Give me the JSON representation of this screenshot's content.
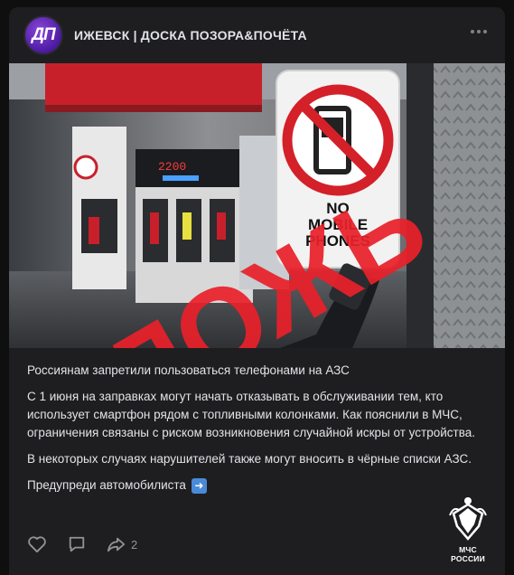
{
  "group": {
    "avatar_text": "ДП",
    "name": "ИЖЕВСК | ДОСКА ПОЗОРА&ПОЧЁТА",
    "menu_icon": "more-horizontal-icon"
  },
  "image": {
    "stamp_text": "ЛОЖЬ",
    "price_display": "2200",
    "sign_text": [
      "NO",
      "MOBILE",
      "PHONES"
    ]
  },
  "post": {
    "title": "Россиянам запретили пользоваться телефонами на АЗС",
    "paragraph1": "С 1 июня на заправках могут начать отказывать в обслуживании тем, кто использует смартфон рядом с топливными колонками. Как пояснили в МЧС, ограничения связаны с риском возникновения случайной искры от устройства.",
    "paragraph2": "В некоторых случаях нарушителей также могут вносить в чёрные списки АЗС.",
    "cta": "Предупреди автомобилиста",
    "cta_icon": "arrow-right-icon"
  },
  "actions": {
    "like_icon": "heart-icon",
    "comment_icon": "comment-icon",
    "share_icon": "share-icon",
    "share_count": "2"
  },
  "watermark": {
    "text": "МЧС РОССИИ"
  },
  "colors": {
    "card_bg": "#1e1e20",
    "page_bg": "#0f0f10",
    "stamp_red": "#e8202a",
    "avatar_purple": "#6a2ec0"
  }
}
